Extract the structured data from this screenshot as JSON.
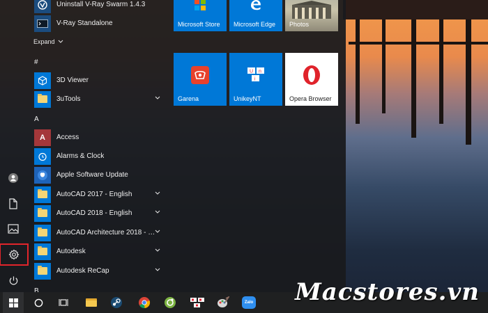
{
  "colors": {
    "tile_blue": "#0078d7",
    "accent_red": "#e2252b",
    "folder_yellow": "#f4d576",
    "access_red": "#a4373a"
  },
  "applist": {
    "top_items": [
      {
        "label": "Uninstall V-Ray Swarm 1.4.3",
        "icon": "vray-icon"
      },
      {
        "label": "V-Ray Standalone",
        "icon": "vray-standalone-icon"
      }
    ],
    "expand_label": "Expand",
    "hash_header": "#",
    "hash_items": [
      {
        "label": "3D Viewer",
        "icon": "3d-viewer-icon"
      },
      {
        "label": "3uTools",
        "icon": "folder-icon"
      }
    ],
    "a_header": "A",
    "a_items": [
      {
        "label": "Access",
        "icon": "access-icon"
      },
      {
        "label": "Alarms & Clock",
        "icon": "alarm-clock-icon"
      },
      {
        "label": "Apple Software Update",
        "icon": "apple-update-icon"
      },
      {
        "label": "AutoCAD 2017 - English",
        "icon": "folder-icon"
      },
      {
        "label": "AutoCAD 2018 - English",
        "icon": "folder-icon"
      },
      {
        "label": "AutoCAD Architecture 2018 - En...",
        "icon": "folder-icon"
      },
      {
        "label": "Autodesk",
        "icon": "folder-icon"
      },
      {
        "label": "Autodesk ReCap",
        "icon": "folder-icon"
      }
    ],
    "b_header": "B"
  },
  "tiles": [
    {
      "label": "Microsoft Store",
      "icon": "store-icon"
    },
    {
      "label": "Microsoft Edge",
      "icon": "edge-icon"
    },
    {
      "label": "Photos",
      "icon": "photos-icon"
    },
    {
      "label": "Garena",
      "icon": "garena-icon"
    },
    {
      "label": "UnikeyNT",
      "icon": "unikey-icon"
    },
    {
      "label": "Opera Browser",
      "icon": "opera-icon"
    }
  ],
  "taskbar": {
    "pinned": [
      "file-explorer-icon",
      "steam-icon",
      "chrome-icon",
      "coc-coc-icon",
      "unikey-icon",
      "paint-icon",
      "zalo-icon"
    ],
    "zalo_label": "Zalo"
  },
  "watermark": "Macstores.vn"
}
